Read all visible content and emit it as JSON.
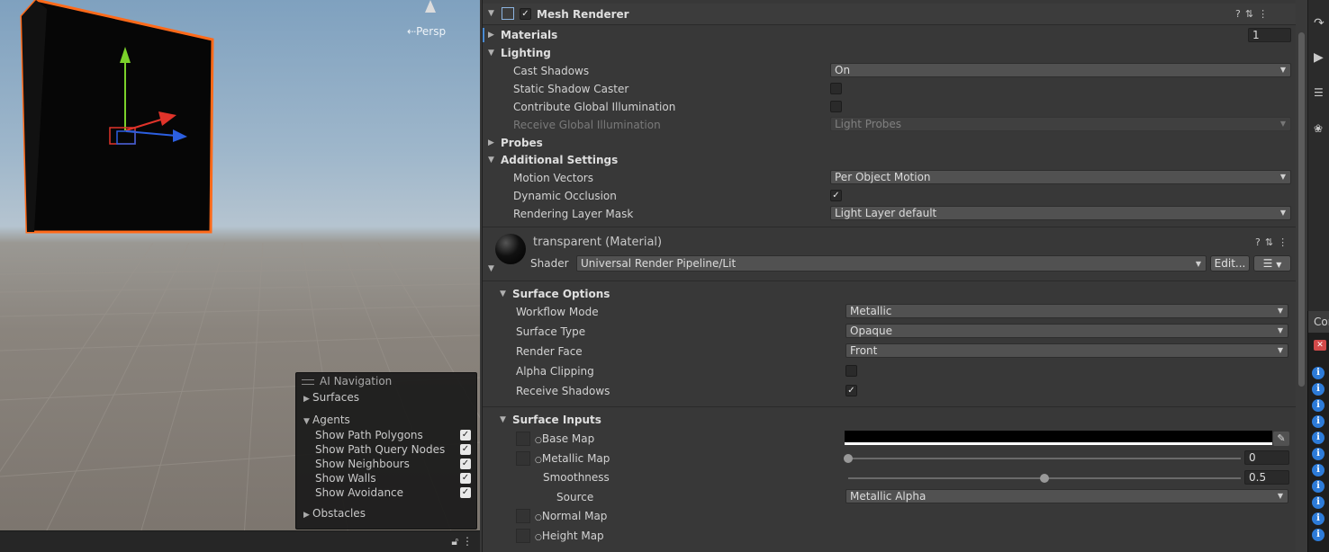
{
  "scene": {
    "persp_label": "Persp",
    "ai_navigation": {
      "title": "AI Navigation",
      "surfaces": "Surfaces",
      "agents": "Agents",
      "obstacles": "Obstacles",
      "options": [
        {
          "label": "Show Path Polygons",
          "checked": true
        },
        {
          "label": "Show Path Query Nodes",
          "checked": true
        },
        {
          "label": "Show Neighbours",
          "checked": true
        },
        {
          "label": "Show Walls",
          "checked": true
        },
        {
          "label": "Show Avoidance",
          "checked": true
        }
      ]
    }
  },
  "mesh_renderer": {
    "title": "Mesh Renderer",
    "materials": {
      "label": "Materials",
      "count": "1"
    },
    "lighting": {
      "label": "Lighting",
      "cast_shadows": {
        "label": "Cast Shadows",
        "value": "On"
      },
      "static_shadow_caster": {
        "label": "Static Shadow Caster",
        "checked": false
      },
      "contribute_gi": {
        "label": "Contribute Global Illumination",
        "checked": false
      },
      "receive_gi": {
        "label": "Receive Global Illumination",
        "value": "Light Probes"
      }
    },
    "probes": {
      "label": "Probes"
    },
    "additional": {
      "label": "Additional Settings",
      "motion_vectors": {
        "label": "Motion Vectors",
        "value": "Per Object Motion"
      },
      "dynamic_occlusion": {
        "label": "Dynamic Occlusion",
        "checked": true
      },
      "rendering_layer_mask": {
        "label": "Rendering Layer Mask",
        "value": "Light Layer default"
      }
    }
  },
  "material": {
    "title": "transparent (Material)",
    "shader_label": "Shader",
    "shader_value": "Universal Render Pipeline/Lit",
    "edit_label": "Edit...",
    "surface_options": {
      "label": "Surface Options",
      "workflow_mode": {
        "label": "Workflow Mode",
        "value": "Metallic"
      },
      "surface_type": {
        "label": "Surface Type",
        "value": "Opaque"
      },
      "render_face": {
        "label": "Render Face",
        "value": "Front"
      },
      "alpha_clipping": {
        "label": "Alpha Clipping",
        "checked": false
      },
      "receive_shadows": {
        "label": "Receive Shadows",
        "checked": true
      }
    },
    "surface_inputs": {
      "label": "Surface Inputs",
      "base_map": {
        "label": "Base Map",
        "color": "#000000"
      },
      "metallic_map": {
        "label": "Metallic Map",
        "value": "0",
        "fraction": 0
      },
      "smoothness": {
        "label": "Smoothness",
        "value": "0.5",
        "fraction": 0.5
      },
      "source": {
        "label": "Source",
        "value": "Metallic Alpha"
      },
      "normal_map": {
        "label": "Normal Map"
      },
      "height_map": {
        "label": "Height Map"
      }
    }
  },
  "console": {
    "tab_label": "Cor"
  },
  "colors": {
    "selection_outline": "#ff6a1a",
    "info_icon": "#2d7bd8",
    "inspector_bg": "#383838"
  }
}
